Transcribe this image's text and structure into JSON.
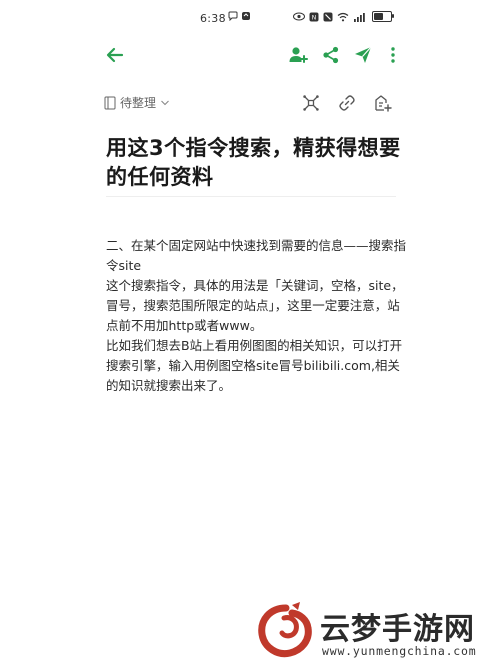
{
  "status_bar": {
    "time": "6:38",
    "icons": [
      "chat-bubble-icon",
      "app-badge-icon",
      "eye-icon",
      "nfc-icon",
      "mute-icon",
      "wifi-icon",
      "signal-icon",
      "battery-icon"
    ]
  },
  "app_bar": {
    "accent_color": "#2aa052",
    "actions": [
      "back-arrow-icon",
      "add-user-icon",
      "share-icon",
      "send-icon",
      "more-icon"
    ]
  },
  "toolbar": {
    "folder_label": "待整理",
    "folder_icon": "notebook-icon",
    "dropdown_icon": "chevron-down-icon",
    "tools": [
      "mind-map-icon",
      "link-icon",
      "add-note-icon"
    ]
  },
  "note": {
    "title": "用这3个指令搜索，精获得想要的任何资料",
    "paragraphs": [
      "二、在某个固定网站中快速找到需要的信息——搜索指令site",
      "这个搜索指令，具体的用法是「关键词，空格，site，冒号，搜索范围所限定的站点」，这里一定要注意，站点前不用加http或者www。",
      "比如我们想去B站上看用例图图的相关知识，可以打开搜索引擎，输入用例图空格site冒号bilibili.com,相关的知识就搜索出来了。"
    ]
  },
  "watermark": {
    "brand": "云梦手游网",
    "url": "www.yunmengchina.com",
    "brand_color": "#c0392b"
  }
}
